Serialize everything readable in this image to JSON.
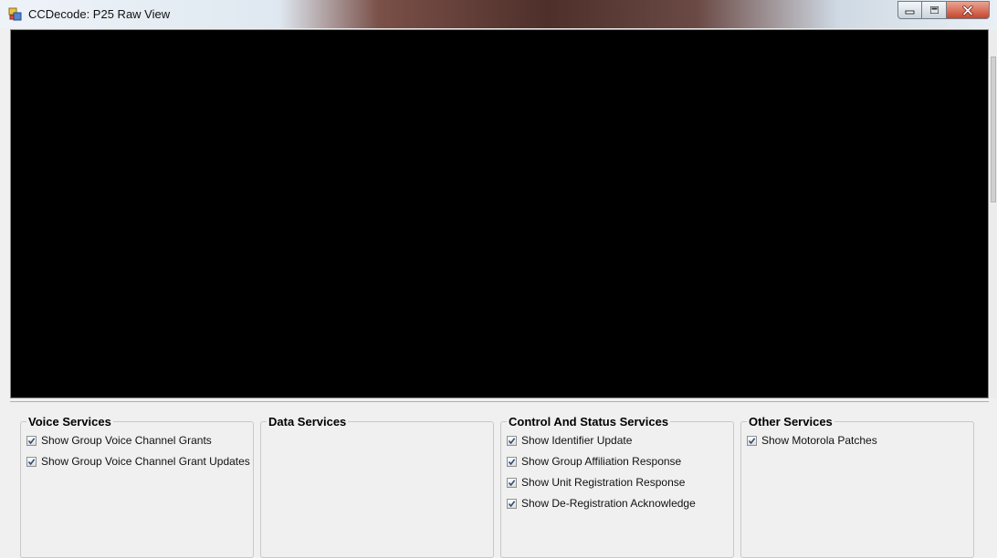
{
  "window": {
    "title": "CCDecode: P25 Raw View"
  },
  "icons": {
    "app": "app-icon",
    "minimize": "minimize-icon",
    "maximize": "maximize-icon",
    "close": "close-icon",
    "checkmark": "checkmark-icon"
  },
  "groups": {
    "voice": {
      "title": "Voice Services",
      "items": [
        {
          "label": "Show Group Voice Channel Grants",
          "checked": true
        },
        {
          "label": "Show Group Voice Channel Grant Updates",
          "checked": true
        }
      ]
    },
    "data": {
      "title": "Data Services",
      "items": []
    },
    "control": {
      "title": "Control And Status Services",
      "items": [
        {
          "label": "Show Identifier Update",
          "checked": true
        },
        {
          "label": "Show Group Affiliation Response",
          "checked": true
        },
        {
          "label": "Show Unit Registration Response",
          "checked": true
        },
        {
          "label": "Show De-Registration Acknowledge",
          "checked": true
        }
      ]
    },
    "other": {
      "title": "Other Services",
      "items": [
        {
          "label": "Show Motorola Patches",
          "checked": true
        }
      ]
    }
  },
  "colors": {
    "raw_view_background": "#000000",
    "window_background": "#f0f0f0"
  }
}
